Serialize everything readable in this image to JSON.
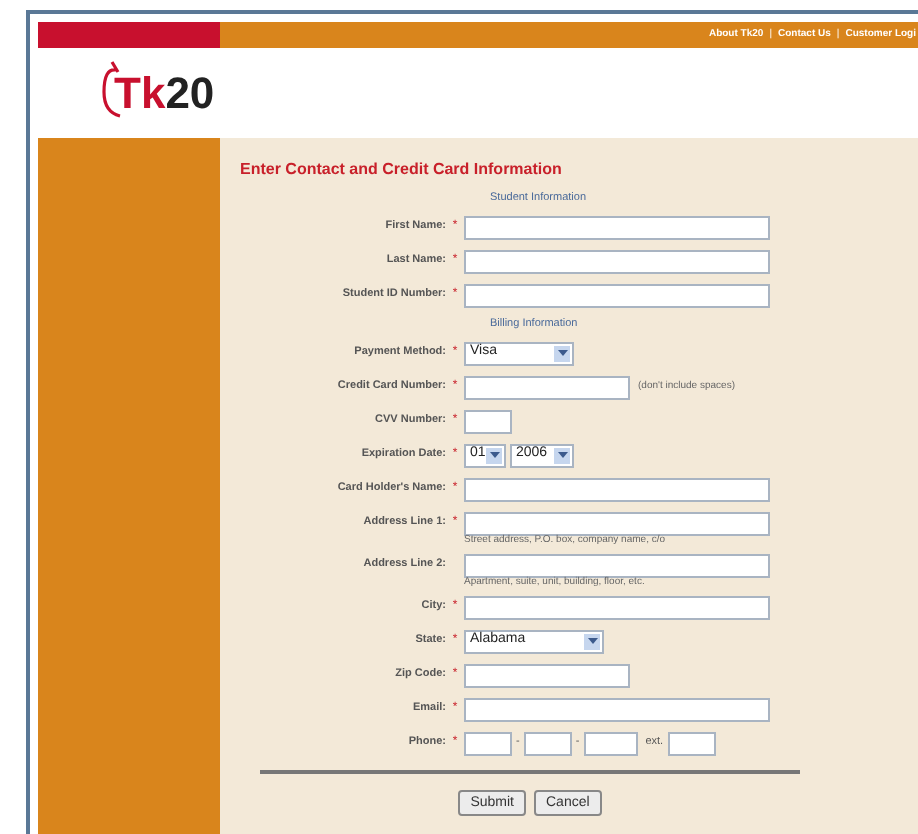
{
  "nav_links": [
    "About Tk20",
    "Contact Us",
    "Customer Logi"
  ],
  "logo": {
    "mark": "Tk",
    "number": "20"
  },
  "title": "Enter Contact and Credit Card Information",
  "sections": [
    {
      "heading": "Student Information",
      "fields": [
        {
          "label": "First Name:",
          "required": true,
          "kind": "long"
        },
        {
          "label": "Last Name:",
          "required": true,
          "kind": "long"
        },
        {
          "label": "Student ID Number:",
          "required": true,
          "kind": "long"
        }
      ]
    },
    {
      "heading": "Billing Information",
      "fields": [
        {
          "label": "Payment Method:",
          "required": true,
          "kind": "select",
          "values": [
            "Visa"
          ]
        },
        {
          "label": "Credit Card Number:",
          "required": true,
          "kind": "medium",
          "note": "(don't include spaces)"
        },
        {
          "label": "CVV Number:",
          "required": true,
          "kind": "short"
        },
        {
          "label": "Expiration Date:",
          "required": true,
          "kind": "date",
          "values": [
            "01",
            "2006"
          ]
        },
        {
          "label": "Card Holder's Name:",
          "required": true,
          "kind": "long"
        },
        {
          "label": "Address Line 1:",
          "required": true,
          "kind": "long",
          "hint": "Street address, P.O. box, company name, c/o"
        },
        {
          "label": "Address Line 2:",
          "required": false,
          "kind": "long",
          "hint": "Apartment, suite, unit, building, floor, etc."
        },
        {
          "label": "City:",
          "required": true,
          "kind": "long"
        },
        {
          "label": "State:",
          "required": true,
          "kind": "select",
          "values": [
            "Alabama"
          ]
        },
        {
          "label": "Zip Code:",
          "required": true,
          "kind": "medium"
        },
        {
          "label": "Email:",
          "required": true,
          "kind": "long"
        },
        {
          "label": "Phone:",
          "required": true,
          "kind": "phone",
          "separators": [
            "-",
            "-"
          ],
          "ext_label": "ext."
        }
      ]
    }
  ],
  "required_mark": "*",
  "nav_separator": "|",
  "buttons": [
    "Submit",
    "Cancel"
  ]
}
